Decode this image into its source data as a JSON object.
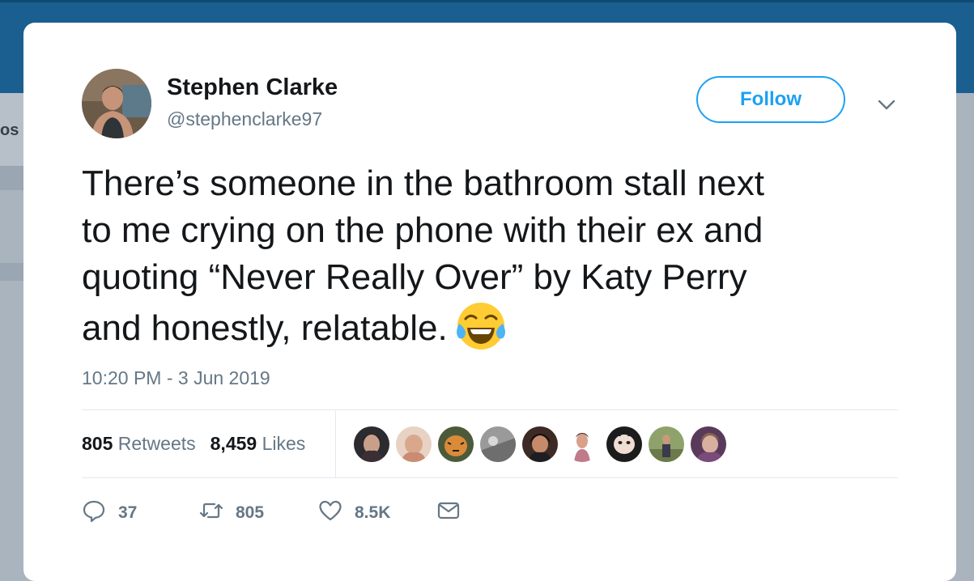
{
  "background": {
    "peek_text": "os"
  },
  "tweet": {
    "author": {
      "name": "Stephen Clarke",
      "handle": "@stephenclarke97"
    },
    "follow_label": "Follow",
    "text_lines": [
      "There’s someone in the bathroom stall next",
      "to me crying on the phone with their ex and",
      "quoting “Never Really Over” by Katy Perry",
      "and honestly, relatable."
    ],
    "emoji": "face-with-tears-of-joy",
    "timestamp": "10:20 PM - 3 Jun 2019",
    "stats": {
      "retweets": {
        "count": "805",
        "label": "Retweets"
      },
      "likes": {
        "count": "8,459",
        "label": "Likes"
      }
    },
    "actions": {
      "reply": {
        "count": "37",
        "icon": "reply-icon"
      },
      "retweet": {
        "count": "805",
        "icon": "retweet-icon"
      },
      "like": {
        "count": "8.5K",
        "icon": "heart-icon"
      },
      "dm": {
        "icon": "envelope-icon"
      }
    }
  },
  "colors": {
    "accent": "#1da1f2",
    "text_primary": "#14171a",
    "text_secondary": "#657786",
    "divider": "#e1e8ed",
    "topbar": "#1a5f8f"
  }
}
